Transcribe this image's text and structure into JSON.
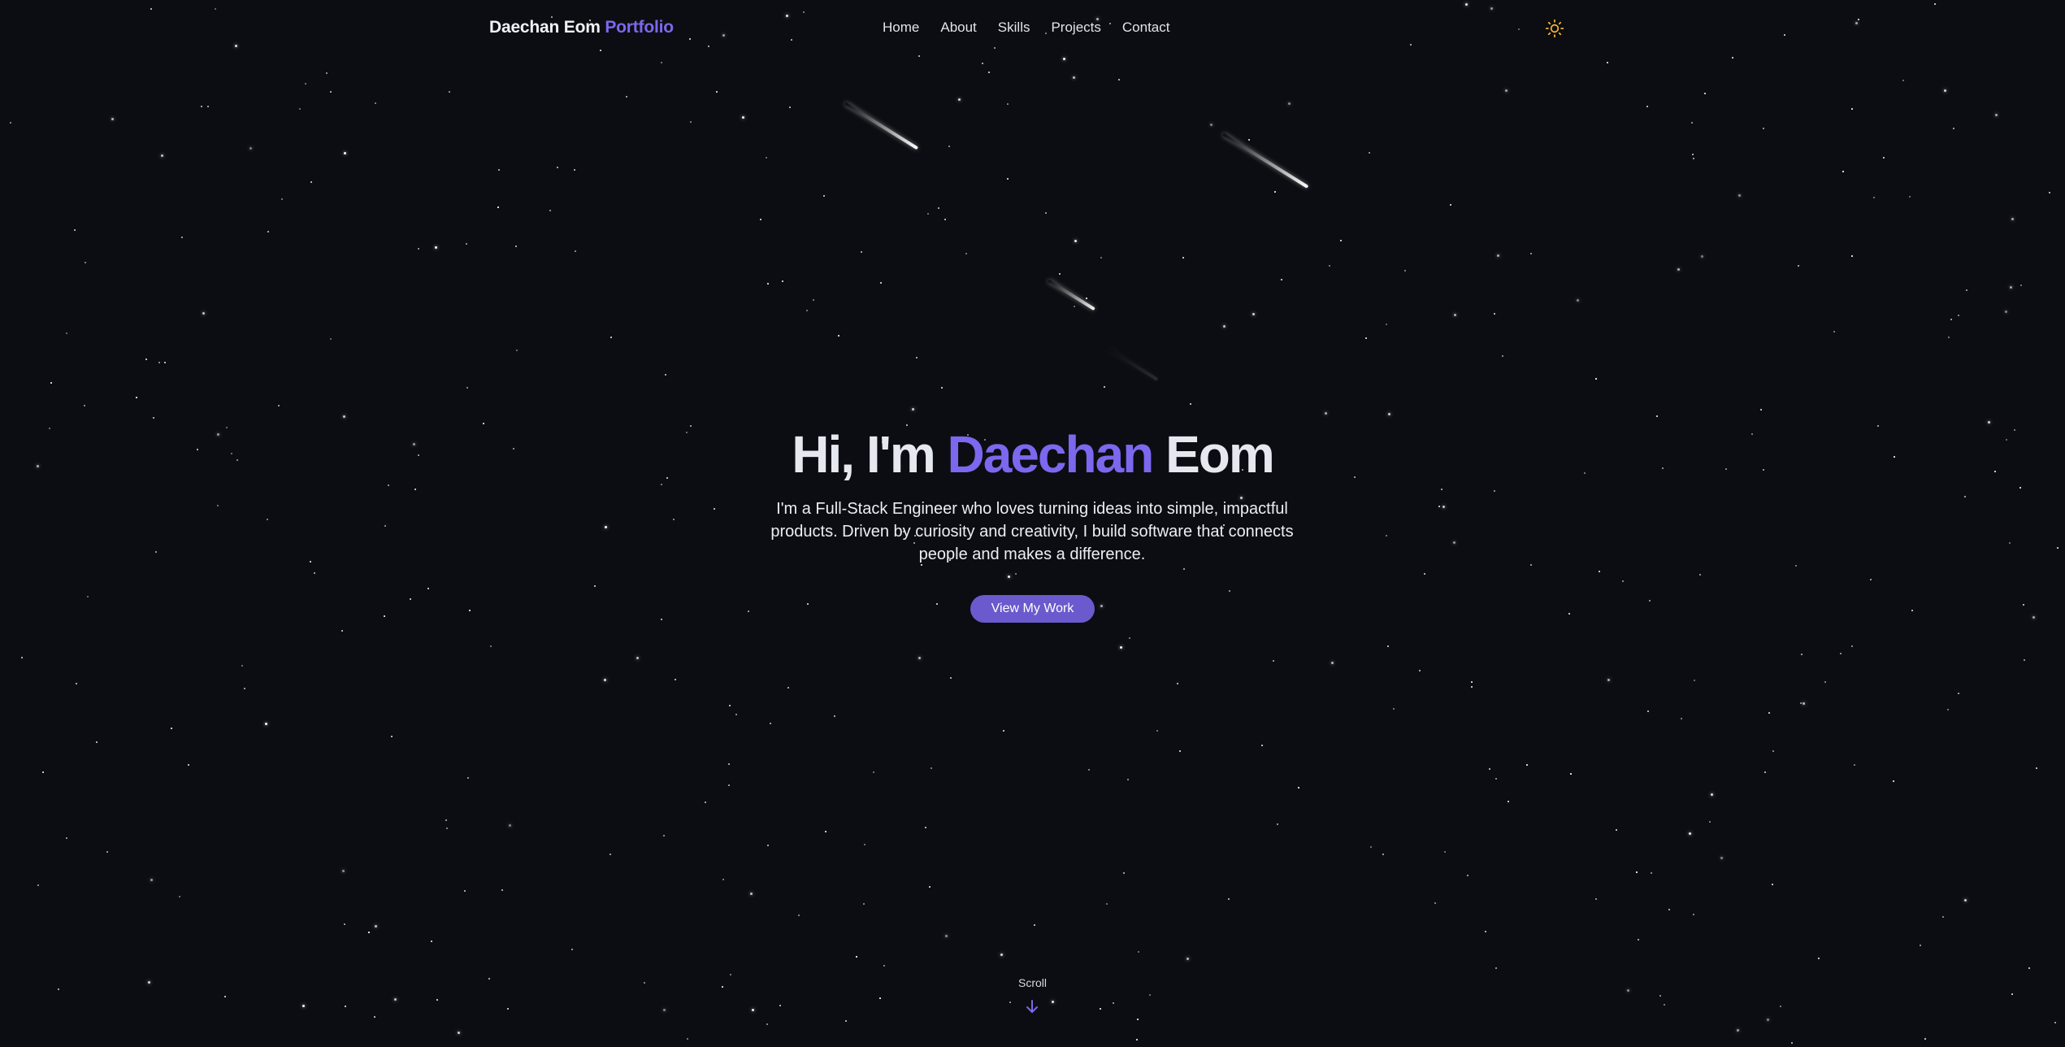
{
  "brand": {
    "name": "Daechan Eom",
    "accent": "Portfolio"
  },
  "nav": {
    "items": [
      {
        "label": "Home"
      },
      {
        "label": "About"
      },
      {
        "label": "Skills"
      },
      {
        "label": "Projects"
      },
      {
        "label": "Contact"
      }
    ],
    "theme_icon": "sun-icon"
  },
  "hero": {
    "greeting": "Hi, I'm",
    "first_name": "Daechan",
    "last_name": "Eom",
    "description": "I'm a Full-Stack Engineer who loves turning ideas into simple, impactful products. Driven by curiosity and creativity, I build software that connects people and makes a difference.",
    "cta_label": "View My Work"
  },
  "scroll": {
    "label": "Scroll",
    "icon": "arrow-down-icon"
  },
  "colors": {
    "background": "#0c0d12",
    "accent": "#7b68ee",
    "button": "#6a5acd",
    "sun": "#f5b731",
    "text": "#e6e8f0"
  }
}
